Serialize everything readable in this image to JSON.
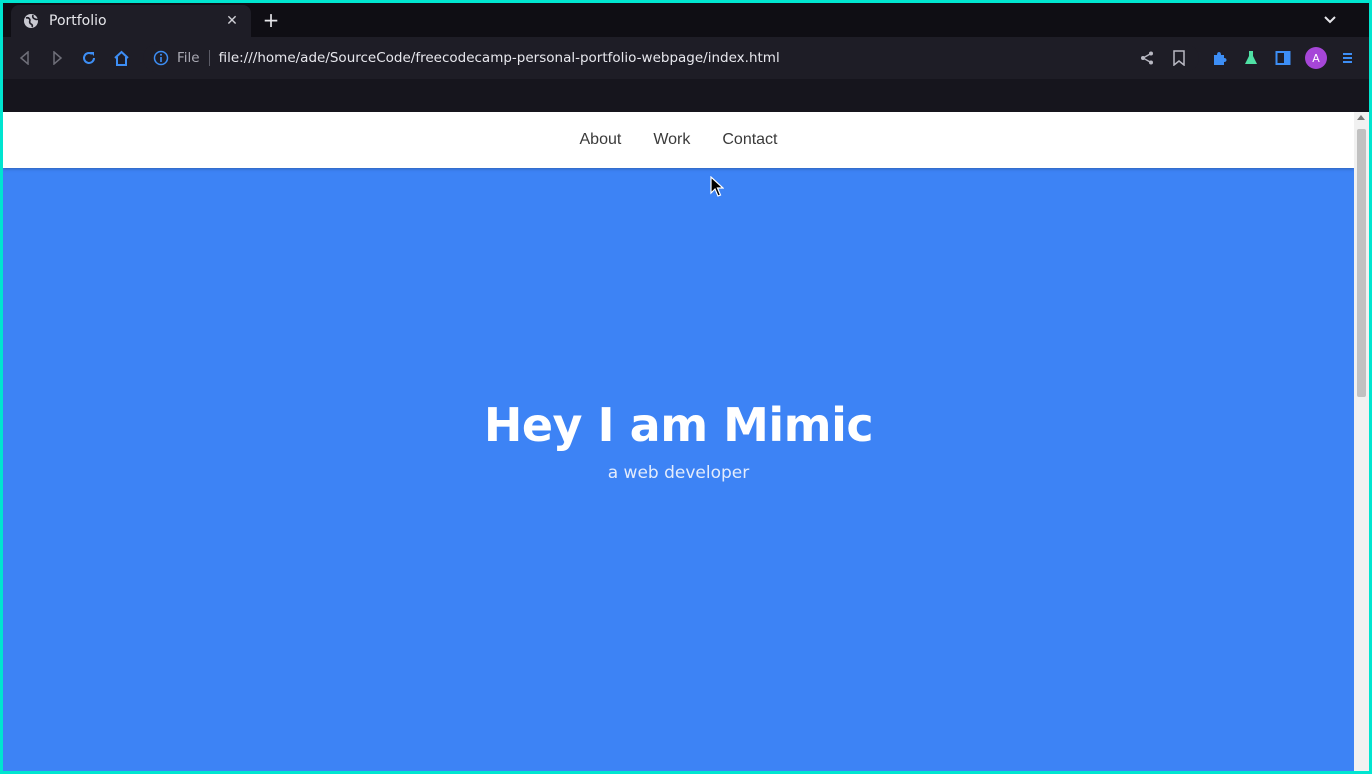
{
  "browser": {
    "tab": {
      "title": "Portfolio",
      "icon": "globe-icon",
      "close_glyph": "✕"
    },
    "new_tab_glyph": "+",
    "url": {
      "scheme_label": "File",
      "address": "file:///home/ade/SourceCode/freecodecamp-personal-portfolio-webpage/index.html"
    },
    "profile_initial": "A",
    "colors": {
      "accent": "#3d83f5",
      "profile": "#a646d8",
      "labs": "#4fe0a4"
    }
  },
  "site": {
    "nav": [
      {
        "label": "About"
      },
      {
        "label": "Work"
      },
      {
        "label": "Contact"
      }
    ],
    "hero": {
      "title": "Hey I am Mimic",
      "subtitle": "a web developer"
    },
    "colors": {
      "hero_bg": "#3d83f5",
      "nav_bg": "#ffffff"
    }
  }
}
